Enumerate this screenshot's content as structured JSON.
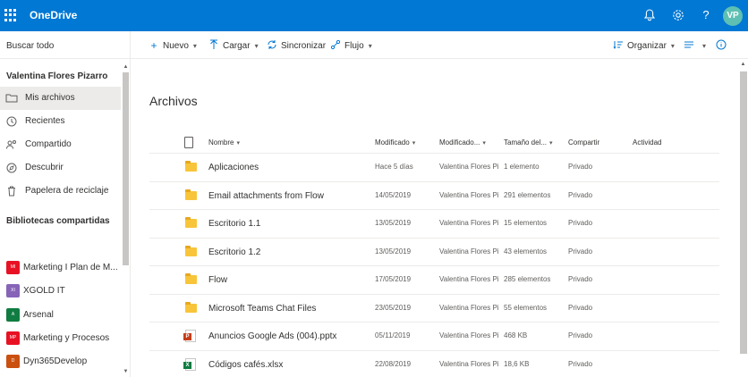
{
  "header": {
    "app_name": "OneDrive",
    "avatar_initials": "VP",
    "help_glyph": "?"
  },
  "search": {
    "label": "Buscar todo"
  },
  "nav": {
    "user_name": "Valentina Flores Pizarro",
    "items": [
      {
        "label": "Mis archivos",
        "icon": "folder-icon",
        "active": true
      },
      {
        "label": "Recientes",
        "icon": "clock-icon"
      },
      {
        "label": "Compartido",
        "icon": "people-icon"
      },
      {
        "label": "Descubrir",
        "icon": "compass-icon"
      },
      {
        "label": "Papelera de reciclaje",
        "icon": "trash-icon"
      }
    ],
    "shared_libraries_title": "Bibliotecas compartidas",
    "libraries": [
      {
        "label": "Marketing I Plan de M...",
        "badge": "MI",
        "color": "#e81123"
      },
      {
        "label": "XGOLD IT",
        "badge": "XI",
        "color": "#8764b8"
      },
      {
        "label": "Arsenal",
        "badge": "A",
        "color": "#107c41"
      },
      {
        "label": "Marketing y Procesos",
        "badge": "MP",
        "color": "#e81123"
      },
      {
        "label": "Dyn365Develop",
        "badge": "D",
        "color": "#ca5010"
      }
    ]
  },
  "commands": {
    "new": "Nuevo",
    "upload": "Cargar",
    "sync": "Sincronizar",
    "flow": "Flujo",
    "organize": "Organizar"
  },
  "main": {
    "title": "Archivos",
    "columns": {
      "name": "Nombre",
      "modified": "Modificado",
      "modified_by": "Modificado...",
      "size": "Tamaño del...",
      "sharing": "Compartir",
      "activity": "Actividad"
    },
    "rows": [
      {
        "type": "folder",
        "name": "Aplicaciones",
        "modified": "Hace 5 días",
        "modified_by": "Valentina Flores Pi",
        "size": "1 elemento",
        "sharing": "Privado"
      },
      {
        "type": "folder",
        "name": "Email attachments from Flow",
        "modified": "14/05/2019",
        "modified_by": "Valentina Flores Pi",
        "size": "291 elementos",
        "sharing": "Privado"
      },
      {
        "type": "folder",
        "name": "Escritorio 1.1",
        "modified": "13/05/2019",
        "modified_by": "Valentina Flores Pi",
        "size": "15 elementos",
        "sharing": "Privado"
      },
      {
        "type": "folder",
        "name": "Escritorio 1.2",
        "modified": "13/05/2019",
        "modified_by": "Valentina Flores Pi",
        "size": "43 elementos",
        "sharing": "Privado"
      },
      {
        "type": "folder",
        "name": "Flow",
        "modified": "17/05/2019",
        "modified_by": "Valentina Flores Pi",
        "size": "285 elementos",
        "sharing": "Privado"
      },
      {
        "type": "folder",
        "name": "Microsoft Teams Chat Files",
        "modified": "23/05/2019",
        "modified_by": "Valentina Flores Pi",
        "size": "55 elementos",
        "sharing": "Privado"
      },
      {
        "type": "pptx",
        "name": "Anuncios Google Ads (004).pptx",
        "modified": "05/11/2019",
        "modified_by": "Valentina Flores Pi",
        "size": "468 KB",
        "sharing": "Privado"
      },
      {
        "type": "xlsx",
        "name": "Códigos cafés.xlsx",
        "modified": "22/08/2019",
        "modified_by": "Valentina Flores Pi",
        "size": "18,6 KB",
        "sharing": "Privado"
      }
    ]
  }
}
